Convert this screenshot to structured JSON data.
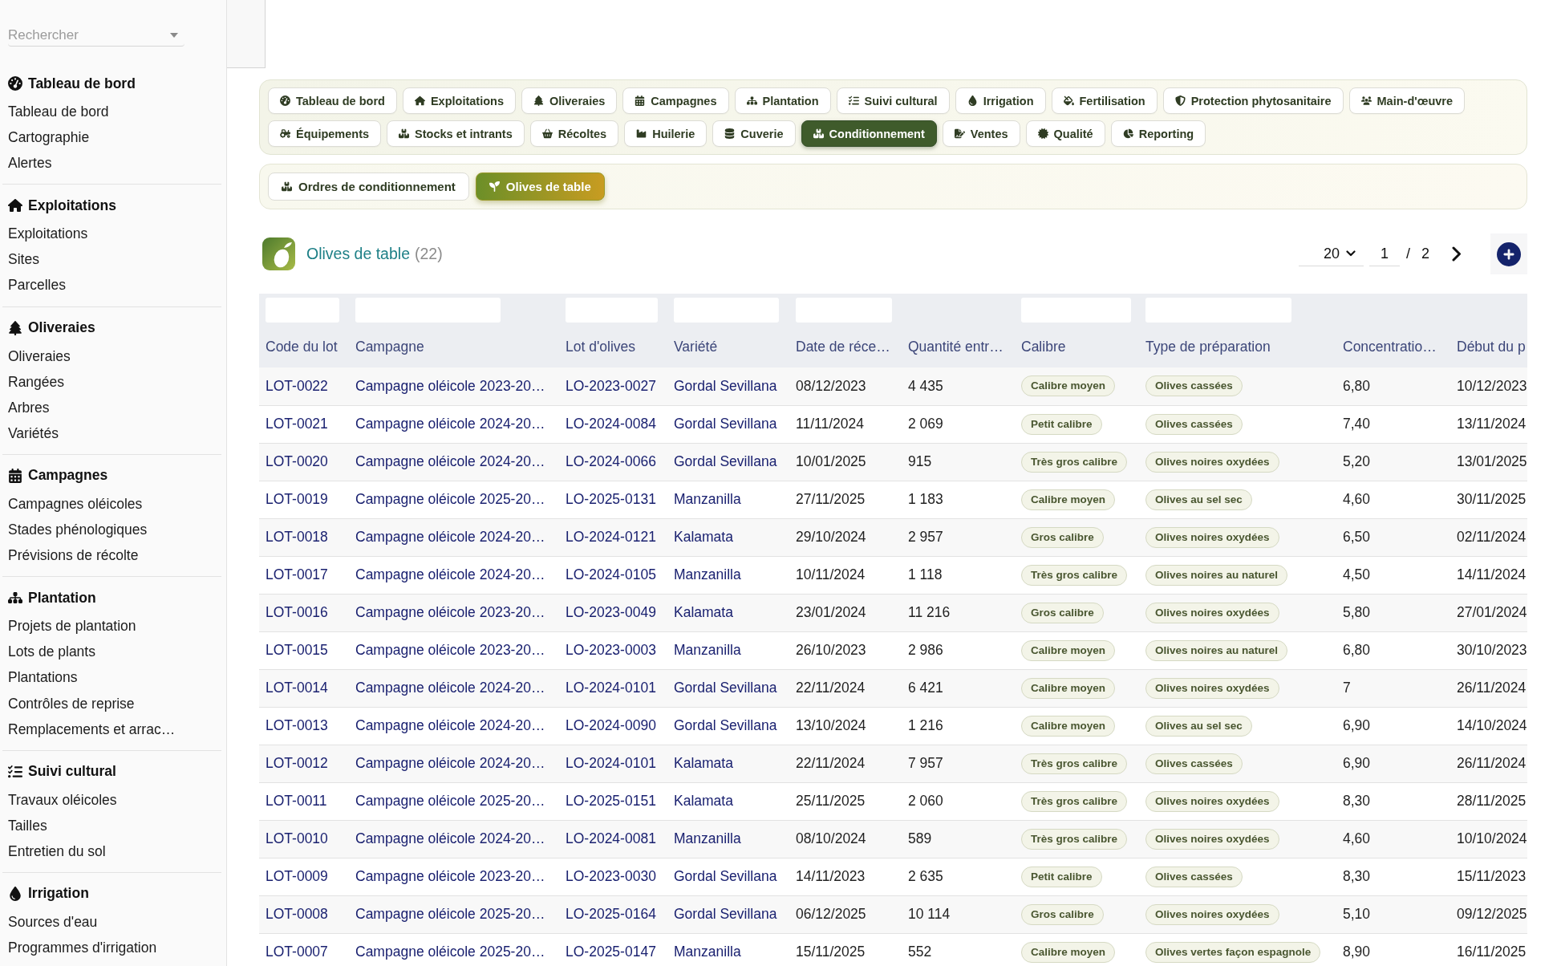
{
  "sidebar": {
    "search": {
      "placeholder": "Rechercher"
    },
    "sections": [
      {
        "heading": "Tableau de bord",
        "items": [
          "Tableau de bord",
          "Cartographie",
          "Alertes"
        ]
      },
      {
        "heading": "Exploitations",
        "items": [
          "Exploitations",
          "Sites",
          "Parcelles"
        ]
      },
      {
        "heading": "Oliveraies",
        "items": [
          "Oliveraies",
          "Rangées",
          "Arbres",
          "Variétés"
        ]
      },
      {
        "heading": "Campagnes",
        "items": [
          "Campagnes oléicoles",
          "Stades phénologiques",
          "Prévisions de récolte"
        ]
      },
      {
        "heading": "Plantation",
        "items": [
          "Projets de plantation",
          "Lots de plants",
          "Plantations",
          "Contrôles de reprise",
          "Remplacements et arrac…"
        ]
      },
      {
        "heading": "Suivi cultural",
        "items": [
          "Travaux oléicoles",
          "Tailles",
          "Entretien du sol"
        ]
      },
      {
        "heading": "Irrigation",
        "items": [
          "Sources d'eau",
          "Programmes d'irrigation"
        ]
      }
    ]
  },
  "nav_tabs": [
    {
      "label": "Tableau de bord",
      "selected": false
    },
    {
      "label": "Exploitations",
      "selected": false
    },
    {
      "label": "Oliveraies",
      "selected": false
    },
    {
      "label": "Campagnes",
      "selected": false
    },
    {
      "label": "Plantation",
      "selected": false
    },
    {
      "label": "Suivi cultural",
      "selected": false
    },
    {
      "label": "Irrigation",
      "selected": false
    },
    {
      "label": "Fertilisation",
      "selected": false
    },
    {
      "label": "Protection phytosanitaire",
      "selected": false
    },
    {
      "label": "Main-d'œuvre",
      "selected": false
    },
    {
      "label": "Équipements",
      "selected": false
    },
    {
      "label": "Stocks et intrants",
      "selected": false
    },
    {
      "label": "Récoltes",
      "selected": false
    },
    {
      "label": "Huilerie",
      "selected": false
    },
    {
      "label": "Cuverie",
      "selected": false
    },
    {
      "label": "Conditionnement",
      "selected": true
    },
    {
      "label": "Ventes",
      "selected": false
    },
    {
      "label": "Qualité",
      "selected": false
    },
    {
      "label": "Reporting",
      "selected": false
    }
  ],
  "sub_tabs": [
    {
      "label": "Ordres de conditionnement",
      "selected": false
    },
    {
      "label": "Olives de table",
      "selected": true
    }
  ],
  "list": {
    "title": "Olives de table",
    "count": "(22)",
    "pagination": {
      "page_size": "20",
      "page": "1",
      "separator": "/",
      "total": "2"
    }
  },
  "table": {
    "columns": [
      {
        "label": "Code du lot",
        "kind": "link",
        "filter": true
      },
      {
        "label": "Campagne",
        "kind": "link",
        "filter": true
      },
      {
        "label": "Lot d'olives",
        "kind": "link",
        "filter": true
      },
      {
        "label": "Variété",
        "kind": "link",
        "filter": true
      },
      {
        "label": "Date de réce…",
        "kind": "text",
        "filter": true
      },
      {
        "label": "Quantité entr…",
        "kind": "text",
        "filter": false
      },
      {
        "label": "Calibre",
        "kind": "tag",
        "filter": true
      },
      {
        "label": "Type de préparation",
        "kind": "tag",
        "filter": true
      },
      {
        "label": "Concentratio…",
        "kind": "text",
        "filter": false
      },
      {
        "label": "Début du p",
        "kind": "text",
        "filter": false
      }
    ],
    "rows": [
      [
        "LOT-0022",
        "Campagne oléicole 2023-20…",
        "LO-2023-0027",
        "Gordal Sevillana",
        "08/12/2023",
        "4 435",
        "Calibre moyen",
        "Olives cassées",
        "6,80",
        "10/12/2023"
      ],
      [
        "LOT-0021",
        "Campagne oléicole 2024-20…",
        "LO-2024-0084",
        "Gordal Sevillana",
        "11/11/2024",
        "2 069",
        "Petit calibre",
        "Olives cassées",
        "7,40",
        "13/11/2024"
      ],
      [
        "LOT-0020",
        "Campagne oléicole 2024-20…",
        "LO-2024-0066",
        "Gordal Sevillana",
        "10/01/2025",
        "915",
        "Très gros calibre",
        "Olives noires oxydées",
        "5,20",
        "13/01/2025"
      ],
      [
        "LOT-0019",
        "Campagne oléicole 2025-20…",
        "LO-2025-0131",
        "Manzanilla",
        "27/11/2025",
        "1 183",
        "Calibre moyen",
        "Olives au sel sec",
        "4,60",
        "30/11/2025"
      ],
      [
        "LOT-0018",
        "Campagne oléicole 2024-20…",
        "LO-2024-0121",
        "Kalamata",
        "29/10/2024",
        "2 957",
        "Gros calibre",
        "Olives noires oxydées",
        "6,50",
        "02/11/2024"
      ],
      [
        "LOT-0017",
        "Campagne oléicole 2024-20…",
        "LO-2024-0105",
        "Manzanilla",
        "10/11/2024",
        "1 118",
        "Très gros calibre",
        "Olives noires au naturel",
        "4,50",
        "14/11/2024"
      ],
      [
        "LOT-0016",
        "Campagne oléicole 2023-20…",
        "LO-2023-0049",
        "Kalamata",
        "23/01/2024",
        "11 216",
        "Gros calibre",
        "Olives noires oxydées",
        "5,80",
        "27/01/2024"
      ],
      [
        "LOT-0015",
        "Campagne oléicole 2023-20…",
        "LO-2023-0003",
        "Manzanilla",
        "26/10/2023",
        "2 986",
        "Calibre moyen",
        "Olives noires au naturel",
        "6,80",
        "30/10/2023"
      ],
      [
        "LOT-0014",
        "Campagne oléicole 2024-20…",
        "LO-2024-0101",
        "Gordal Sevillana",
        "22/11/2024",
        "6 421",
        "Calibre moyen",
        "Olives noires oxydées",
        "7",
        "26/11/2024"
      ],
      [
        "LOT-0013",
        "Campagne oléicole 2024-20…",
        "LO-2024-0090",
        "Gordal Sevillana",
        "13/10/2024",
        "1 216",
        "Calibre moyen",
        "Olives au sel sec",
        "6,90",
        "14/10/2024"
      ],
      [
        "LOT-0012",
        "Campagne oléicole 2024-20…",
        "LO-2024-0101",
        "Kalamata",
        "22/11/2024",
        "7 957",
        "Très gros calibre",
        "Olives cassées",
        "6,90",
        "26/11/2024"
      ],
      [
        "LOT-0011",
        "Campagne oléicole 2025-20…",
        "LO-2025-0151",
        "Kalamata",
        "25/11/2025",
        "2 060",
        "Très gros calibre",
        "Olives noires oxydées",
        "8,30",
        "28/11/2025"
      ],
      [
        "LOT-0010",
        "Campagne oléicole 2024-20…",
        "LO-2024-0081",
        "Manzanilla",
        "08/10/2024",
        "589",
        "Très gros calibre",
        "Olives noires oxydées",
        "4,60",
        "10/10/2024"
      ],
      [
        "LOT-0009",
        "Campagne oléicole 2023-20…",
        "LO-2023-0030",
        "Gordal Sevillana",
        "14/11/2023",
        "2 635",
        "Petit calibre",
        "Olives cassées",
        "8,30",
        "15/11/2023"
      ],
      [
        "LOT-0008",
        "Campagne oléicole 2025-20…",
        "LO-2025-0164",
        "Gordal Sevillana",
        "06/12/2025",
        "10 114",
        "Gros calibre",
        "Olives noires oxydées",
        "5,10",
        "09/12/2025"
      ],
      [
        "LOT-0007",
        "Campagne oléicole 2025-20…",
        "LO-2025-0147",
        "Manzanilla",
        "15/11/2025",
        "552",
        "Calibre moyen",
        "Olives vertes façon espagnole",
        "8,90",
        "16/11/2025"
      ]
    ]
  }
}
